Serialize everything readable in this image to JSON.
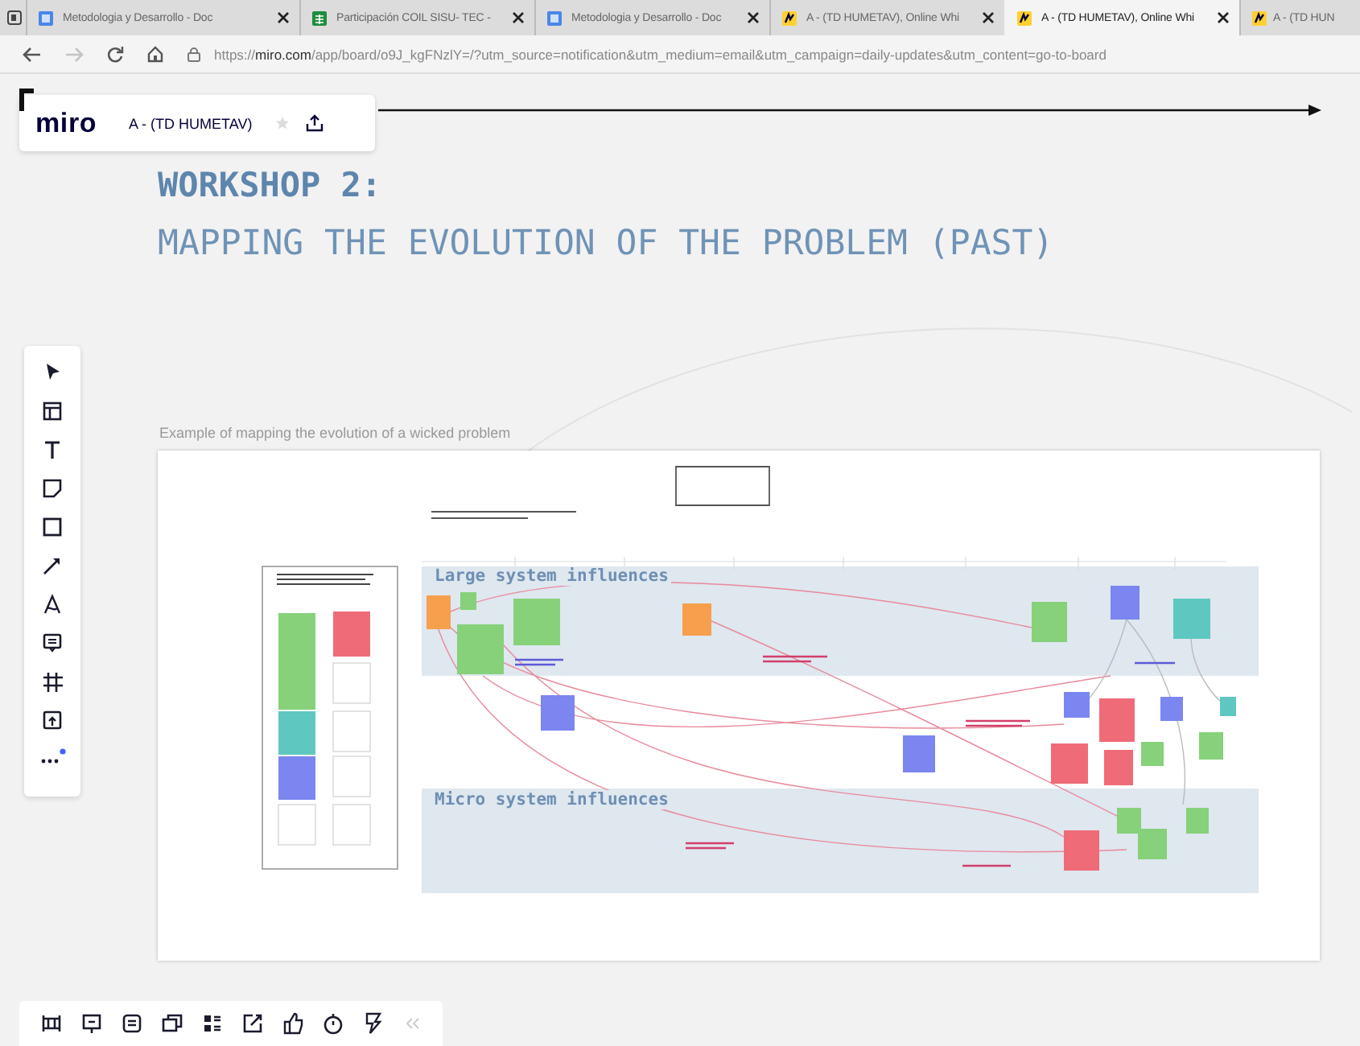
{
  "tabs": [
    {
      "kind": "doc",
      "title": "Metodologia y Desarrollo - Doc",
      "selected": false
    },
    {
      "kind": "sheet",
      "title": "Participación COIL SISU- TEC - ",
      "selected": false
    },
    {
      "kind": "doc",
      "title": "Metodologia y Desarrollo - Doc",
      "selected": false
    },
    {
      "kind": "board",
      "title": "A - (TD HUMETAV), Online Whi",
      "selected": false
    },
    {
      "kind": "board",
      "title": "A - (TD HUMETAV), Online Whi",
      "selected": true
    },
    {
      "kind": "board",
      "title": "A - (TD HUN",
      "selected": false
    }
  ],
  "address_bar": {
    "url": "https://**miro.com**/app/board/o9J_kgFNzlY=/?utm_source=notification&utm_medium=email&utm_campaign=daily-updates&utm_content=go-to-board"
  },
  "board_header": {
    "logo": "miro",
    "board_name": "A - (TD HUMETAV)"
  },
  "heading": {
    "line_1": "WORKSHOP 2:",
    "line_2": "MAPPING THE EVOLUTION OF THE PROBLEM (PAST)"
  },
  "frame": {
    "caption": "Example of mapping the evolution of a wicked problem",
    "lanes": [
      {
        "label": "Large system influences"
      },
      {
        "label": "Micro system influences"
      }
    ]
  }
}
